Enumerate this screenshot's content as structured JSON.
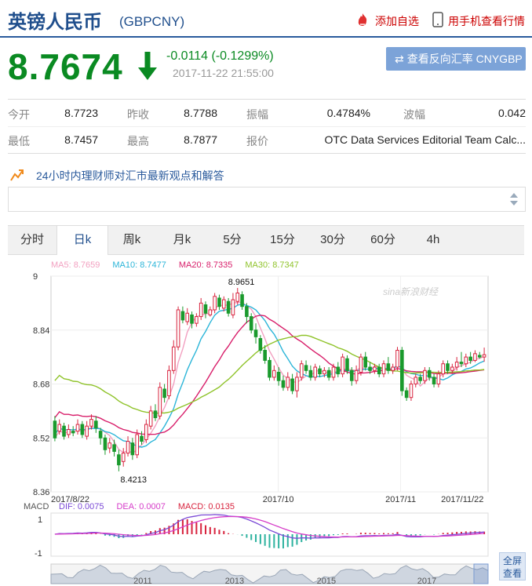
{
  "header": {
    "title": "英镑人民币",
    "code": "(GBPCNY)",
    "favorite_label": "添加自选",
    "mobile_label": "用手机查看行情",
    "colors": {
      "brand": "#1f4e8c",
      "link_red": "#cc0000"
    }
  },
  "quote": {
    "price": "8.7674",
    "change": "-0.0114 (-0.1299%)",
    "timestamp": "2017-11-22 21:55:00",
    "direction_icon": "down-arrow-icon",
    "color": "#0a8a22",
    "reverse_button": "查看反向汇率 CNYGBP"
  },
  "stats": [
    [
      {
        "label": "今开",
        "value": "8.7723"
      },
      {
        "label": "昨收",
        "value": "8.7788"
      },
      {
        "label": "振幅",
        "value": "0.4784%"
      },
      {
        "label": "波幅",
        "value": "0.042"
      }
    ],
    [
      {
        "label": "最低",
        "value": "8.7457"
      },
      {
        "label": "最高",
        "value": "8.7877"
      },
      {
        "label": "报价",
        "value": "OTC Data Services Editorial Team Calc..."
      }
    ]
  ],
  "advisor": {
    "text": "24小时内理财师对汇市最新观点和解答"
  },
  "tabs": [
    {
      "label": "分时",
      "active": false
    },
    {
      "label": "日k",
      "active": true
    },
    {
      "label": "周k",
      "active": false
    },
    {
      "label": "月k",
      "active": false
    },
    {
      "label": "5分",
      "active": false
    },
    {
      "label": "15分",
      "active": false
    },
    {
      "label": "30分",
      "active": false
    },
    {
      "label": "60分",
      "active": false
    },
    {
      "label": "4h",
      "active": false
    }
  ],
  "chart_data": [
    {
      "type": "candlestick",
      "ma_legend": [
        {
          "label": "MA5: 8.7659",
          "color": "#f2a0c0"
        },
        {
          "label": "MA10: 8.7477",
          "color": "#2bb5d8"
        },
        {
          "label": "MA20: 8.7335",
          "color": "#d81e6a"
        },
        {
          "label": "MA30: 8.7347",
          "color": "#8fc32a"
        }
      ],
      "y_ticks": [
        "9",
        "8.84",
        "8.68",
        "8.52",
        "8.36"
      ],
      "ylim": [
        8.36,
        9.0
      ],
      "x_labels": [
        "2017/8/22",
        "2017/10",
        "2017/11",
        "2017/11/22"
      ],
      "annotations": {
        "high": "8.9651",
        "low": "8.4213"
      },
      "watermark": "sina新浪财经",
      "up_color": "#d8253f",
      "down_color": "#1a9a2d",
      "candles": [
        [
          8.57,
          8.52,
          8.585,
          8.51
        ],
        [
          8.54,
          8.56,
          8.575,
          8.53
        ],
        [
          8.555,
          8.525,
          8.565,
          8.515
        ],
        [
          8.53,
          8.545,
          8.56,
          8.52
        ],
        [
          8.54,
          8.535,
          8.555,
          8.525
        ],
        [
          8.54,
          8.56,
          8.575,
          8.53
        ],
        [
          8.56,
          8.53,
          8.57,
          8.52
        ],
        [
          8.525,
          8.555,
          8.57,
          8.515
        ],
        [
          8.555,
          8.575,
          8.59,
          8.545
        ],
        [
          8.57,
          8.55,
          8.585,
          8.535
        ],
        [
          8.54,
          8.52,
          8.55,
          8.5
        ],
        [
          8.52,
          8.485,
          8.53,
          8.47
        ],
        [
          8.49,
          8.505,
          8.52,
          8.475
        ],
        [
          8.5,
          8.48,
          8.515,
          8.465
        ],
        [
          8.47,
          8.44,
          8.485,
          8.421
        ],
        [
          8.45,
          8.475,
          8.49,
          8.435
        ],
        [
          8.475,
          8.51,
          8.525,
          8.465
        ],
        [
          8.505,
          8.47,
          8.52,
          8.455
        ],
        [
          8.47,
          8.53,
          8.545,
          8.46
        ],
        [
          8.525,
          8.51,
          8.54,
          8.5
        ],
        [
          8.515,
          8.56,
          8.575,
          8.505
        ],
        [
          8.555,
          8.6,
          8.615,
          8.545
        ],
        [
          8.6,
          8.58,
          8.62,
          8.57
        ],
        [
          8.585,
          8.67,
          8.685,
          8.575
        ],
        [
          8.665,
          8.64,
          8.68,
          8.625
        ],
        [
          8.645,
          8.72,
          8.735,
          8.635
        ],
        [
          8.72,
          8.79,
          8.81,
          8.71
        ],
        [
          8.79,
          8.9,
          8.91,
          8.78
        ],
        [
          8.895,
          8.87,
          8.91,
          8.86
        ],
        [
          8.865,
          8.89,
          8.905,
          8.855
        ],
        [
          8.885,
          8.86,
          8.895,
          8.845
        ],
        [
          8.86,
          8.88,
          8.89,
          8.85
        ],
        [
          8.88,
          8.92,
          8.935,
          8.87
        ],
        [
          8.915,
          8.89,
          8.925,
          8.875
        ],
        [
          8.885,
          8.9,
          8.91,
          8.88
        ],
        [
          8.9,
          8.94,
          8.95,
          8.89
        ],
        [
          8.935,
          8.91,
          8.945,
          8.9
        ],
        [
          8.905,
          8.93,
          8.94,
          8.895
        ],
        [
          8.925,
          8.89,
          8.935,
          8.88
        ],
        [
          8.885,
          8.93,
          8.95,
          8.875
        ],
        [
          8.925,
          8.95,
          8.965,
          8.915
        ],
        [
          8.945,
          8.91,
          8.955,
          8.9
        ],
        [
          8.91,
          8.88,
          8.92,
          8.86
        ],
        [
          8.88,
          8.84,
          8.89,
          8.83
        ],
        [
          8.84,
          8.82,
          8.86,
          8.8
        ],
        [
          8.815,
          8.78,
          8.825,
          8.77
        ],
        [
          8.78,
          8.75,
          8.795,
          8.74
        ],
        [
          8.75,
          8.7,
          8.76,
          8.69
        ],
        [
          8.7,
          8.72,
          8.735,
          8.69
        ],
        [
          8.715,
          8.69,
          8.73,
          8.675
        ],
        [
          8.69,
          8.67,
          8.705,
          8.66
        ],
        [
          8.67,
          8.7,
          8.715,
          8.66
        ],
        [
          8.695,
          8.66,
          8.71,
          8.65
        ],
        [
          8.66,
          8.7,
          8.715,
          8.64
        ],
        [
          8.7,
          8.74,
          8.75,
          8.69
        ],
        [
          8.735,
          8.72,
          8.75,
          8.71
        ],
        [
          8.72,
          8.7,
          8.735,
          8.69
        ],
        [
          8.7,
          8.73,
          8.74,
          8.69
        ],
        [
          8.725,
          8.71,
          8.735,
          8.7
        ],
        [
          8.71,
          8.72,
          8.73,
          8.7
        ],
        [
          8.72,
          8.7,
          8.73,
          8.69
        ],
        [
          8.7,
          8.73,
          8.74,
          8.69
        ],
        [
          8.73,
          8.71,
          8.745,
          8.7
        ],
        [
          8.71,
          8.76,
          8.77,
          8.7
        ],
        [
          8.755,
          8.72,
          8.765,
          8.71
        ],
        [
          8.72,
          8.69,
          8.73,
          8.675
        ],
        [
          8.69,
          8.72,
          8.735,
          8.68
        ],
        [
          8.715,
          8.76,
          8.77,
          8.705
        ],
        [
          8.76,
          8.73,
          8.775,
          8.72
        ],
        [
          8.73,
          8.72,
          8.745,
          8.71
        ],
        [
          8.72,
          8.73,
          8.74,
          8.71
        ],
        [
          8.73,
          8.71,
          8.74,
          8.7
        ],
        [
          8.71,
          8.74,
          8.75,
          8.7
        ],
        [
          8.74,
          8.72,
          8.76,
          8.71
        ],
        [
          8.72,
          8.73,
          8.74,
          8.71
        ],
        [
          8.73,
          8.78,
          8.79,
          8.72
        ],
        [
          8.78,
          8.66,
          8.79,
          8.645
        ],
        [
          8.66,
          8.64,
          8.67,
          8.63
        ],
        [
          8.64,
          8.68,
          8.69,
          8.63
        ],
        [
          8.68,
          8.7,
          8.71,
          8.67
        ],
        [
          8.7,
          8.69,
          8.71,
          8.68
        ],
        [
          8.69,
          8.72,
          8.73,
          8.68
        ],
        [
          8.72,
          8.7,
          8.73,
          8.69
        ],
        [
          8.7,
          8.68,
          8.71,
          8.67
        ],
        [
          8.68,
          8.71,
          8.72,
          8.67
        ],
        [
          8.71,
          8.74,
          8.75,
          8.7
        ],
        [
          8.74,
          8.72,
          8.75,
          8.71
        ],
        [
          8.72,
          8.73,
          8.74,
          8.71
        ],
        [
          8.73,
          8.745,
          8.76,
          8.72
        ],
        [
          8.745,
          8.74,
          8.775,
          8.73
        ],
        [
          8.74,
          8.76,
          8.77,
          8.73
        ],
        [
          8.76,
          8.75,
          8.775,
          8.74
        ],
        [
          8.75,
          8.77,
          8.78,
          8.745
        ],
        [
          8.765,
          8.76,
          8.775,
          8.755
        ],
        [
          8.76,
          8.767,
          8.788,
          8.746
        ]
      ]
    },
    {
      "type": "macd",
      "label": "MACD",
      "legend": [
        {
          "label": "DIF: 0.0075",
          "color": "#7b4ad6"
        },
        {
          "label": "DEA: 0.0007",
          "color": "#d63dc9"
        },
        {
          "label": "MACD: 0.0135",
          "color": "#d8253f"
        }
      ],
      "y_ticks": [
        "1",
        "-1"
      ]
    },
    {
      "type": "area",
      "role": "range-navigator",
      "x_labels": [
        "2011",
        "2013",
        "2015",
        "2017"
      ]
    }
  ],
  "fullscreen_label": "全屏查看"
}
